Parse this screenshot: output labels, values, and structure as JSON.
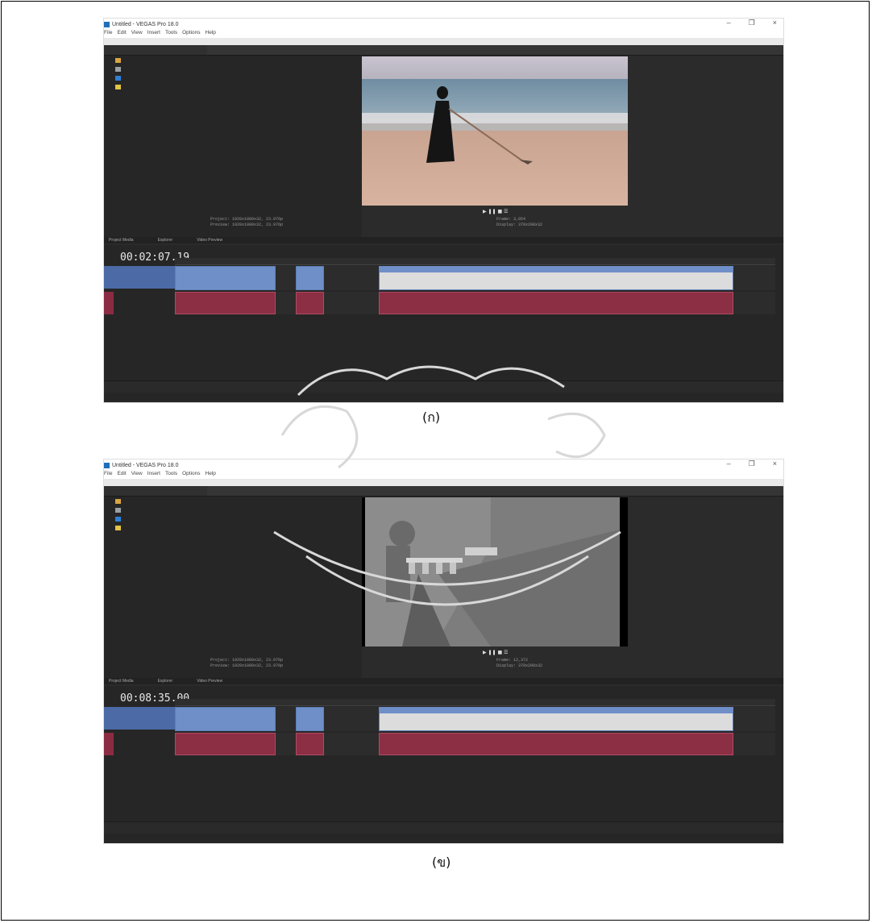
{
  "figures": [
    {
      "window_title": "Untitled - VEGAS Pro 18.0",
      "menu": [
        "File",
        "Edit",
        "View",
        "Insert",
        "Tools",
        "Options",
        "Help"
      ],
      "timecode": "00:02:07.19",
      "caption": "(ก)"
    },
    {
      "window_title": "Untitled - VEGAS Pro 18.0",
      "menu": [
        "File",
        "Edit",
        "View",
        "Insert",
        "Tools",
        "Options",
        "Help"
      ],
      "timecode": "00:08:35.00",
      "caption": "(ข)"
    }
  ],
  "watermark_text": "มหาวิทยาลัยศิลปากร",
  "colors": {
    "video_clip": "#6f8fc8",
    "audio_clip": "#8c2f45",
    "app_bg": "#2b2b2b"
  }
}
